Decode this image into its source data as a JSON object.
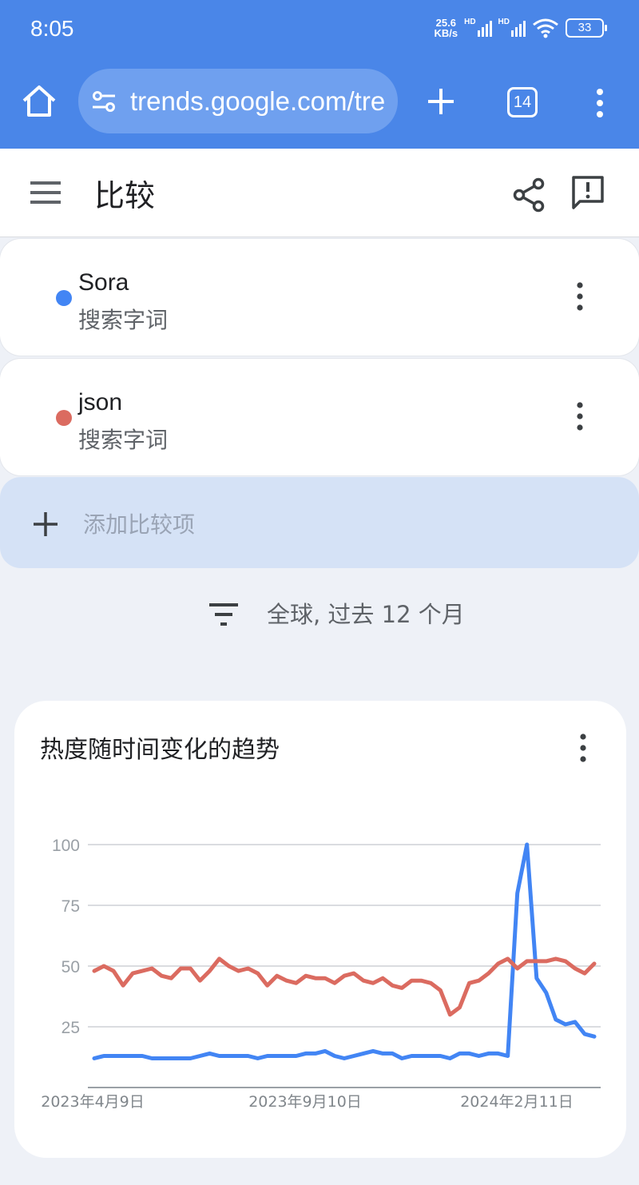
{
  "status_bar": {
    "time": "8:05",
    "net_speed_value": "25.6",
    "net_speed_unit": "KB/s",
    "hd_label": "HD",
    "battery": "33"
  },
  "browser": {
    "url": "trends.google.com/tre",
    "tab_count": "14",
    "icons": [
      "home-icon",
      "tune-icon",
      "new-tab-icon",
      "tab-switcher-icon",
      "more-vert-icon"
    ]
  },
  "appbar": {
    "title": "比较",
    "icons": [
      "menu-icon",
      "share-icon",
      "feedback-icon"
    ]
  },
  "terms": [
    {
      "name": "Sora",
      "type": "搜索字词",
      "color": "#4285f4"
    },
    {
      "name": "json",
      "type": "搜索字词",
      "color": "#db6b60"
    }
  ],
  "add_compare": {
    "label": "添加比较项"
  },
  "filter": {
    "text": "全球, 过去 12 个月"
  },
  "chart_card": {
    "title": "热度随时间变化的趋势"
  },
  "chart_data": {
    "type": "line",
    "y_ticks": [
      "100",
      "75",
      "50",
      "25"
    ],
    "x_tick_labels": [
      "2023年4月9日",
      "2023年9月10日",
      "2024年2月11日"
    ],
    "ylim": [
      0,
      100
    ],
    "grid": true,
    "series": [
      {
        "name": "Sora",
        "color": "#4285f4",
        "values": [
          12,
          13,
          13,
          13,
          13,
          13,
          12,
          12,
          12,
          12,
          12,
          13,
          14,
          13,
          13,
          13,
          13,
          12,
          13,
          13,
          13,
          13,
          14,
          14,
          15,
          13,
          12,
          13,
          14,
          15,
          14,
          14,
          12,
          13,
          13,
          13,
          13,
          12,
          14,
          14,
          13,
          14,
          14,
          13,
          80,
          100,
          45,
          39,
          28,
          26,
          27,
          22,
          21
        ]
      },
      {
        "name": "json",
        "color": "#db6b60",
        "values": [
          48,
          50,
          48,
          42,
          47,
          48,
          49,
          46,
          45,
          49,
          49,
          44,
          48,
          53,
          50,
          48,
          49,
          47,
          42,
          46,
          44,
          43,
          46,
          45,
          45,
          43,
          46,
          47,
          44,
          43,
          45,
          42,
          41,
          44,
          44,
          43,
          40,
          30,
          33,
          43,
          44,
          47,
          51,
          53,
          49,
          52,
          52,
          52,
          53,
          52,
          49,
          47,
          51
        ]
      }
    ]
  }
}
